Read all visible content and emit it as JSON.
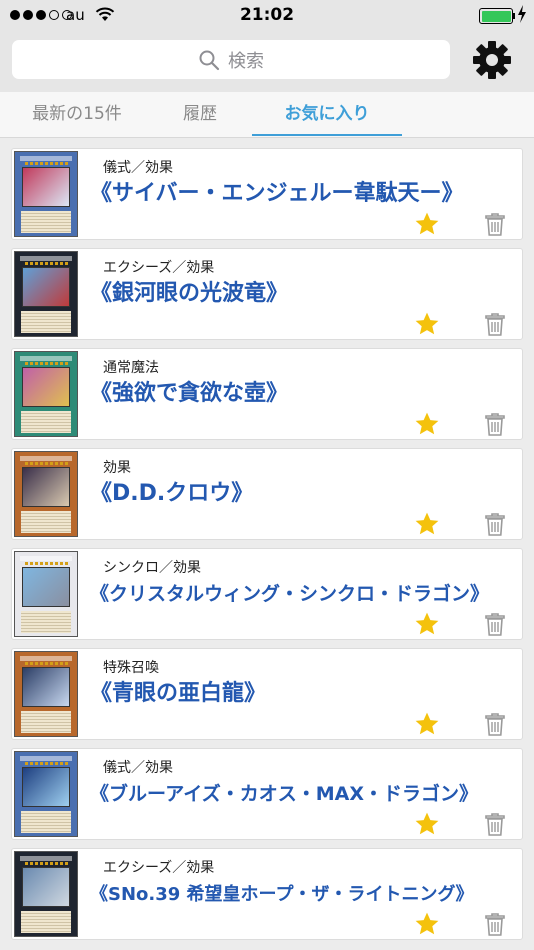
{
  "status_bar": {
    "carrier": "au",
    "time": "21:02",
    "battery_level": 1.0
  },
  "search": {
    "placeholder": "検索"
  },
  "tabs": [
    {
      "label": "最新の15件",
      "selected": false
    },
    {
      "label": "履歴",
      "selected": false
    },
    {
      "label": "お気に入り",
      "selected": true
    }
  ],
  "colors": {
    "accent": "#3f9fd8",
    "card_name": "#2358b0",
    "favorite_star": "#f4c20d",
    "battery": "#34c759"
  },
  "cards": [
    {
      "type": "儀式／効果",
      "name": "《サイバー・エンジェルー韋駄天ー》",
      "favorite": true,
      "thumb_colors": [
        "#4a6fb0",
        "#c13a5c",
        "#dbe7f5"
      ]
    },
    {
      "type": "エクシーズ／効果",
      "name": "《銀河眼の光波竜》",
      "favorite": true,
      "thumb_colors": [
        "#1f2530",
        "#5fa0d8",
        "#c03a3a"
      ]
    },
    {
      "type": "通常魔法",
      "name": "《強欲で貪欲な壺》",
      "favorite": true,
      "thumb_colors": [
        "#2e8b77",
        "#c060a8",
        "#e0c050"
      ]
    },
    {
      "type": "効果",
      "name": "《D.D.クロウ》",
      "favorite": true,
      "thumb_colors": [
        "#b8682c",
        "#3a2f4a",
        "#d9c9b0"
      ]
    },
    {
      "type": "シンクロ／効果",
      "name": "《クリスタルウィング・シンクロ・ドラゴン》",
      "favorite": true,
      "thumb_colors": [
        "#e8e8ec",
        "#7fb6e0",
        "#8a8fa0"
      ]
    },
    {
      "type": "特殊召喚",
      "name": "《青眼の亜白龍》",
      "favorite": true,
      "thumb_colors": [
        "#b8682c",
        "#2c3e66",
        "#c8d8f0"
      ]
    },
    {
      "type": "儀式／効果",
      "name": "《ブルーアイズ・カオス・MAX・ドラゴン》",
      "favorite": true,
      "thumb_colors": [
        "#4a6fb0",
        "#1e3f80",
        "#9fd0f0"
      ]
    },
    {
      "type": "エクシーズ／効果",
      "name": "《SNo.39 希望皇ホープ・ザ・ライトニング》",
      "favorite": true,
      "thumb_colors": [
        "#1f2530",
        "#6a8ab0",
        "#d0d8e0"
      ]
    }
  ]
}
